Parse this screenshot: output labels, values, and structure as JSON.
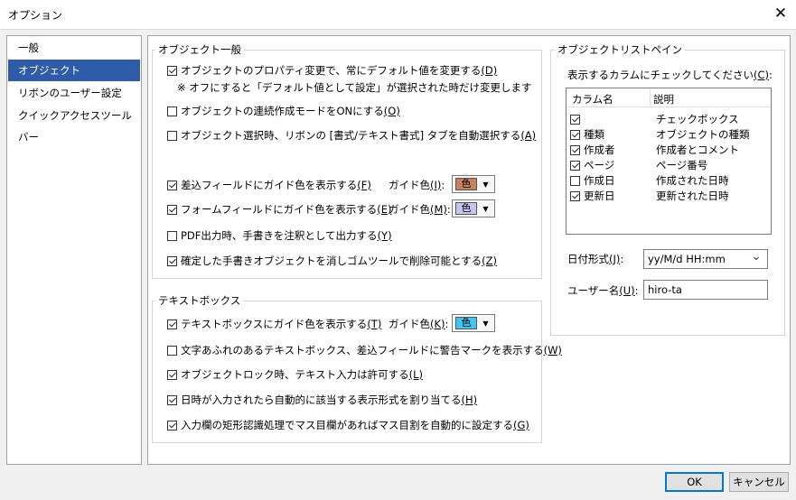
{
  "window": {
    "title": "オプション",
    "close_glyph": "✕"
  },
  "nav": {
    "items": [
      {
        "label": "一般"
      },
      {
        "label": "オブジェクト",
        "selected": true
      },
      {
        "label": "リボンのユーザー設定"
      },
      {
        "label": "クイックアクセスツールバー"
      }
    ]
  },
  "object_general": {
    "legend": "オブジェクト一般",
    "default_value": {
      "checked": true,
      "label": "オブジェクトのプロパティ変更で、常にデフォルト値を変更する",
      "key": "(D)",
      "note": "※ オフにすると「デフォルト値として設定」が選択された時だけ変更します"
    },
    "continuous_mode": {
      "checked": false,
      "label": "オブジェクトの連続作成モードをONにする",
      "key": "(O)"
    },
    "auto_tab": {
      "checked": false,
      "label": "オブジェクト選択時、リボンの [書式/テキスト書式] タブを自動選択する",
      "key": "(A)"
    },
    "insert_field_guide": {
      "checked": true,
      "label": "差込フィールドにガイド色を表示する",
      "key": "(F)",
      "color_label": "ガイド色",
      "color_key": "(I)",
      "swatch_text": "色",
      "swatch_color": "#c7825d"
    },
    "form_field_guide": {
      "checked": true,
      "label": "フォームフィールドにガイド色を表示する",
      "key": "(E)",
      "color_label": "ガイド色",
      "color_key": "(M)",
      "swatch_text": "色",
      "swatch_color": "#c5c3f2"
    },
    "pdf_handwriting": {
      "checked": false,
      "label": "PDF出力時、手書きを注釈として出力する",
      "key": "(Y)"
    },
    "eraser_delete": {
      "checked": true,
      "label": "確定した手書きオブジェクトを消しゴムツールで削除可能とする",
      "key": "(Z)"
    }
  },
  "textbox": {
    "legend": "テキストボックス",
    "guide": {
      "checked": true,
      "label": "テキストボックスにガイド色を表示する",
      "key": "(T)",
      "color_label": "ガイド色",
      "color_key": "(K)",
      "swatch_text": "色",
      "swatch_color": "#3ec6f0"
    },
    "overflow_mark": {
      "checked": false,
      "label": "文字あふれのあるテキストボックス、差込フィールドに警告マークを表示する",
      "key": "(W)"
    },
    "lock_input": {
      "checked": true,
      "label": "オブジェクトロック時、テキスト入力は許可する",
      "key": "(L)"
    },
    "date_format_auto": {
      "checked": true,
      "label": "日時が入力されたら自動的に該当する表示形式を割り当てる",
      "key": "(H)"
    },
    "grid_auto": {
      "checked": true,
      "label": "入力欄の矩形認識処理でマス目欄があればマス目割を自動的に設定する",
      "key": "(G)"
    }
  },
  "list_pane": {
    "legend": "オブジェクトリストペイン",
    "columns_label": "表示するカラムにチェックしてください",
    "columns_key": "(C)",
    "headers": {
      "name": "カラム名",
      "desc": "説明"
    },
    "rows": [
      {
        "checked": true,
        "name": "",
        "desc": "チェックボックス"
      },
      {
        "checked": true,
        "name": "種類",
        "desc": "オブジェクトの種類"
      },
      {
        "checked": true,
        "name": "作成者",
        "desc": "作成者とコメント"
      },
      {
        "checked": true,
        "name": "ページ",
        "desc": "ページ番号"
      },
      {
        "checked": false,
        "name": "作成日",
        "desc": "作成された日時"
      },
      {
        "checked": true,
        "name": "更新日",
        "desc": "更新された日時"
      }
    ],
    "date_format": {
      "label": "日付形式",
      "key": "(J)",
      "value": "yy/M/d HH:mm"
    },
    "user_name": {
      "label": "ユーザー名",
      "key": "(U)",
      "value": "hiro-ta"
    }
  },
  "buttons": {
    "ok": "OK",
    "cancel": "キャンセル"
  },
  "icons": {
    "dropdown": "▼",
    "select_arrow": "⌄"
  }
}
